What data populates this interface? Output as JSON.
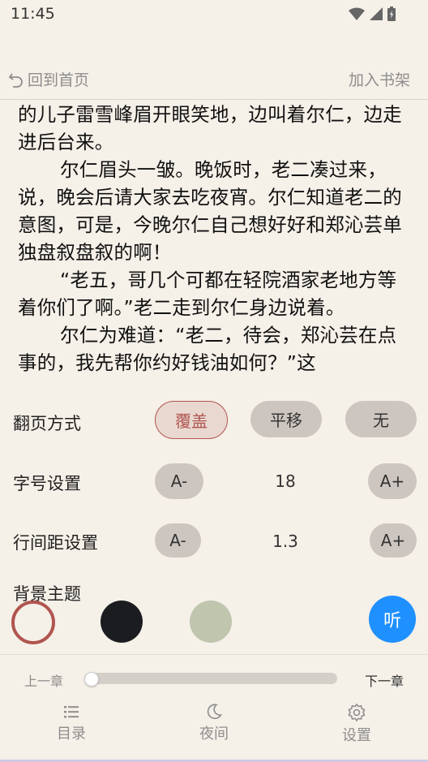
{
  "status": {
    "time": "11:45"
  },
  "nav": {
    "back_label": "回到首页",
    "add_shelf_label": "加入书架"
  },
  "reading": {
    "paragraphs": [
      {
        "text": "的儿子雷雪峰眉开眼笑地，边叫着尔仁，边走进后台来。",
        "indent": false
      },
      {
        "text": "尔仁眉头一皱。晚饭时，老二凑过来，说，晚会后请大家去吃夜宵。尔仁知道老二的意图，可是，今晚尔仁自己想好好和郑沁芸单独盘叙盘叙的啊！",
        "indent": true
      },
      {
        "text": "“老五，哥几个可都在轻院酒家老地方等着你们了啊。”老二走到尔仁身边说着。",
        "indent": true
      },
      {
        "text": "尔仁为难道：“老二，待会，郑沁芸在点事的，我先帮你约好钱油如何？”这",
        "indent": true
      }
    ]
  },
  "settings": {
    "page_turn": {
      "label": "翻页方式",
      "options": [
        "覆盖",
        "平移",
        "无"
      ],
      "selected": "覆盖"
    },
    "font_size": {
      "label": "字号设置",
      "minus": "A-",
      "value": "18",
      "plus": "A+"
    },
    "line_spacing": {
      "label": "行间距设置",
      "minus": "A-",
      "value": "1.3",
      "plus": "A+"
    },
    "theme": {
      "label": "背景主题",
      "colors": [
        "#f5f0e8",
        "#1a1c20",
        "#c0c5ae"
      ],
      "selected_ring": "#b0554f"
    },
    "listen_label": "听"
  },
  "chapter": {
    "prev_label": "上一章",
    "next_label": "下一章",
    "progress": 0
  },
  "tabs": [
    {
      "label": "目录",
      "icon": "list-icon"
    },
    {
      "label": "夜间",
      "icon": "moon-icon"
    },
    {
      "label": "设置",
      "icon": "gear-icon"
    }
  ],
  "colors": {
    "accent": "#b0554f",
    "listen": "#1e90ff",
    "background": "#f5f0e8"
  }
}
